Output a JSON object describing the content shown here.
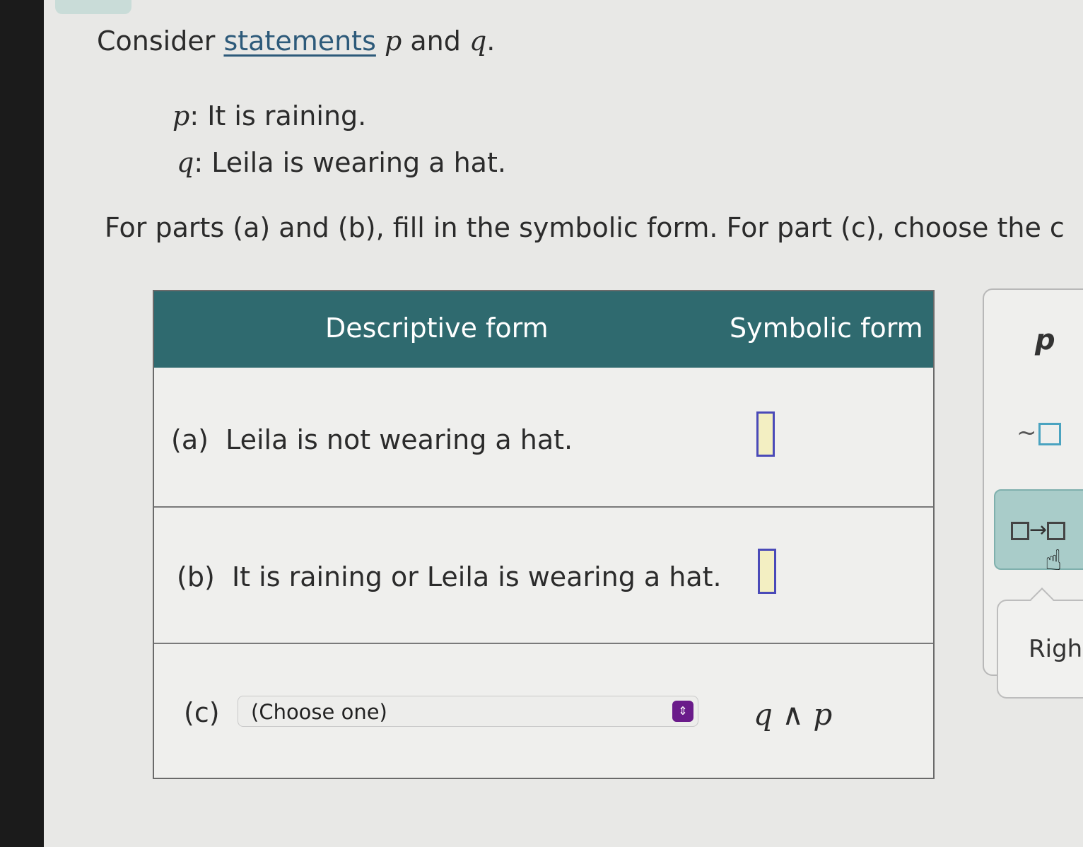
{
  "intro": {
    "prefix": "Consider ",
    "link": "statements",
    "var_p": "p",
    "and": " and ",
    "var_q": "q",
    "suffix": "."
  },
  "statements": [
    {
      "var": "p",
      "text": ": It is raining."
    },
    {
      "var": "q",
      "text": ": Leila is wearing a hat."
    }
  ],
  "instructions": "For parts (a) and (b), fill in the symbolic form. For part (c), choose the c",
  "table": {
    "header_descriptive": "Descriptive form",
    "header_symbolic": "Symbolic form",
    "row_a": {
      "label": "(a)",
      "text": "Leila is not wearing a hat."
    },
    "row_b": {
      "label": "(b)",
      "text": "It is raining or Leila is wearing a hat."
    },
    "row_c": {
      "label": "(c)",
      "select_value": "(Choose one)",
      "symbolic_q": "q",
      "symbolic_op": "∧",
      "symbolic_p": "p"
    }
  },
  "palette": {
    "p_label": "p",
    "not_symbol": "~",
    "cond_arrow": "→",
    "tooltip_label": "Righ"
  },
  "colors": {
    "header_bg": "#2f6a6f",
    "answer_box_border": "#4a4ab8",
    "answer_box_fill": "#f3efc2",
    "select_button": "#6a1b8a",
    "link": "#2d5a7a"
  }
}
